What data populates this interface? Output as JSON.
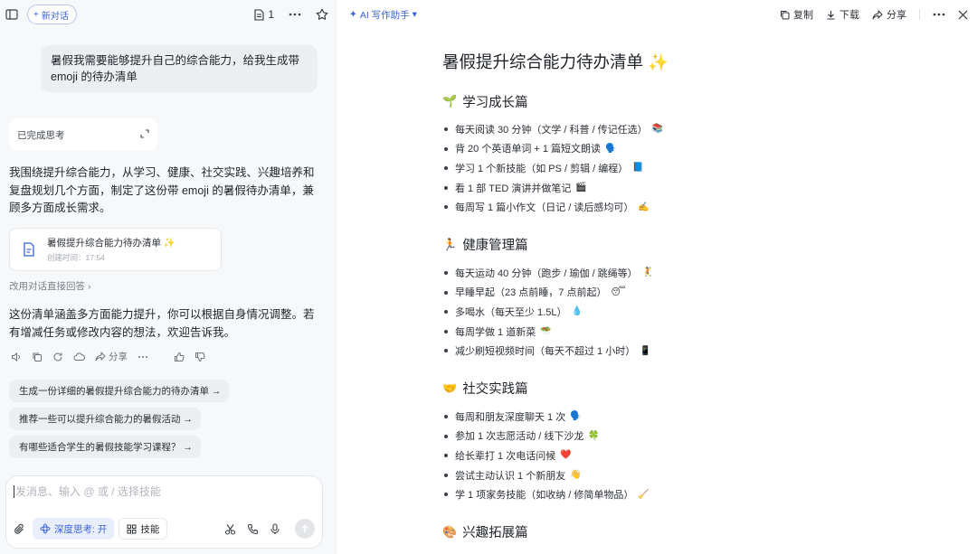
{
  "chat": {
    "new_chat_label": "新对话",
    "doc_count": "1",
    "user_message": "暑假我需要能够提升自己的综合能力，给我生成带 emoji 的待办清单",
    "thinking_label": "已完成思考",
    "reply_intro": "我围绕提升综合能力，从学习、健康、社交实践、兴趣培养和复盘规划几个方面，制定了这份带 emoji 的暑假待办清单，兼顾多方面成长需求。",
    "doc_card": {
      "title": "暑假提升综合能力待办清单 ✨",
      "subtitle": "创建时间：17:54"
    },
    "change_link": "改用对话直接回答",
    "reply_outro": "这份清单涵盖多方面能力提升，你可以根据自身情况调整。若有增减任务或修改内容的想法，欢迎告诉我。",
    "share_label": "分享",
    "suggestions": [
      "生成一份详细的暑假提升综合能力的待办清单 →",
      "推荐一些可以提升综合能力的暑假活动 →",
      "有哪些适合学生的暑假技能学习课程？ →"
    ],
    "composer": {
      "placeholder": "发消息、输入 @ 或 / 选择技能",
      "deep_think_label": "深度思考: 开",
      "skill_label": "技能"
    }
  },
  "doc": {
    "assistant_label": "AI 写作助手",
    "copy_label": "复制",
    "download_label": "下载",
    "share_label": "分享",
    "title": "暑假提升综合能力待办清单 ✨",
    "sections": [
      {
        "emoji": "🌱",
        "title": "学习成长篇",
        "items": [
          {
            "text": "每天阅读 30 分钟（文学 / 科普 / 传记任选）",
            "emoji": "📚"
          },
          {
            "text": "背 20 个英语单词 + 1 篇短文朗读",
            "emoji": "🗣️"
          },
          {
            "text": "学习 1 个新技能（如 PS / 剪辑 / 编程）",
            "emoji": "📘"
          },
          {
            "text": "看 1 部 TED 演讲并做笔记",
            "emoji": "🎬"
          },
          {
            "text": "每周写 1 篇小作文（日记 / 读后感均可）",
            "emoji": "✍️"
          }
        ]
      },
      {
        "emoji": "🏃",
        "title": "健康管理篇",
        "items": [
          {
            "text": "每天运动 40 分钟（跑步 / 瑜伽 / 跳绳等）",
            "emoji": "🤾"
          },
          {
            "text": "早睡早起（23 点前睡，7 点前起）",
            "emoji": "😴"
          },
          {
            "text": "多喝水（每天至少 1.5L）",
            "emoji": "💧"
          },
          {
            "text": "每周学做 1 道新菜",
            "emoji": "🥗"
          },
          {
            "text": "减少刷短视频时间（每天不超过 1 小时）",
            "emoji": "📱"
          }
        ]
      },
      {
        "emoji": "🤝",
        "title": "社交实践篇",
        "items": [
          {
            "text": "每周和朋友深度聊天 1 次",
            "emoji": "🗣️"
          },
          {
            "text": "参加 1 次志愿活动 / 线下沙龙",
            "emoji": "🍀"
          },
          {
            "text": "给长辈打 1 次电话问候",
            "emoji": "❤️"
          },
          {
            "text": "尝试主动认识 1 个新朋友",
            "emoji": "👋"
          },
          {
            "text": "学 1 项家务技能（如收纳 / 修简单物品）",
            "emoji": "🧹"
          }
        ]
      },
      {
        "emoji": "🎨",
        "title": "兴趣拓展篇",
        "items": []
      }
    ]
  }
}
